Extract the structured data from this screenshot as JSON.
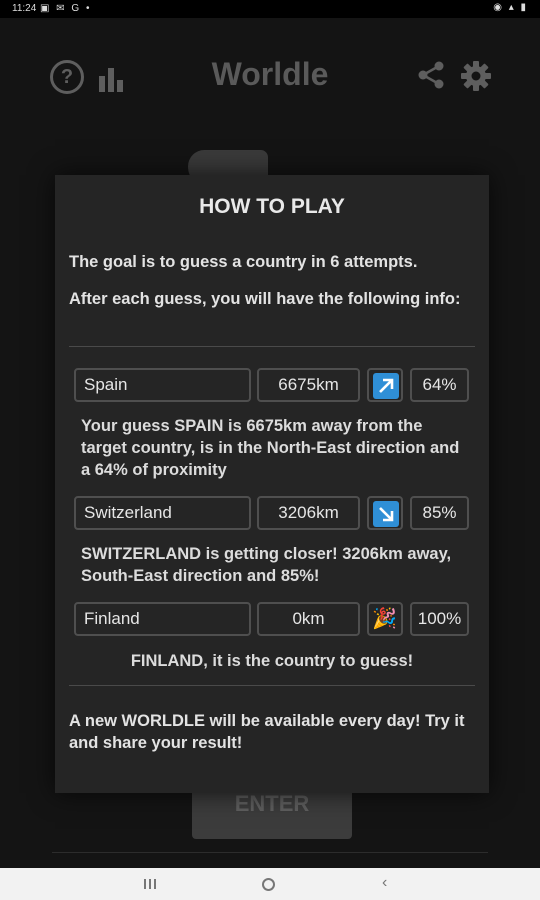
{
  "status_bar": {
    "time": "11:24",
    "left_icons": "▣ ✉ G •",
    "right_icons": "◉ ▴ ▮"
  },
  "header": {
    "app_title": "Worldle",
    "help_glyph": "?"
  },
  "enter_label": "ENTER",
  "modal": {
    "title": "HOW TO PLAY",
    "intro_goal": "The goal is to guess a country in 6 attempts.",
    "intro_info": "After each guess, you will have the following info:",
    "examples": [
      {
        "country": "Spain",
        "distance": "6675km",
        "direction_icon": "north-east-arrow-icon",
        "percent": "64%",
        "description": "Your guess SPAIN is 6675km away from the target country, is in the North-East direction and a 64% of proximity"
      },
      {
        "country": "Switzerland",
        "distance": "3206km",
        "direction_icon": "south-east-arrow-icon",
        "percent": "85%",
        "description": "SWITZERLAND is getting closer! 3206km away, South-East direction and 85%!"
      },
      {
        "country": "Finland",
        "distance": "0km",
        "direction_icon": "party-popper-icon",
        "direction_glyph": "🎉",
        "percent": "100%",
        "description": "FINLAND, it is the country to guess!"
      }
    ],
    "footer": "A new WORLDLE will be available every day! Try it and share your result!"
  },
  "colors": {
    "arrow_tile": "#2f8fd6",
    "modal_bg": "#252525",
    "page_bg": "#141414"
  }
}
